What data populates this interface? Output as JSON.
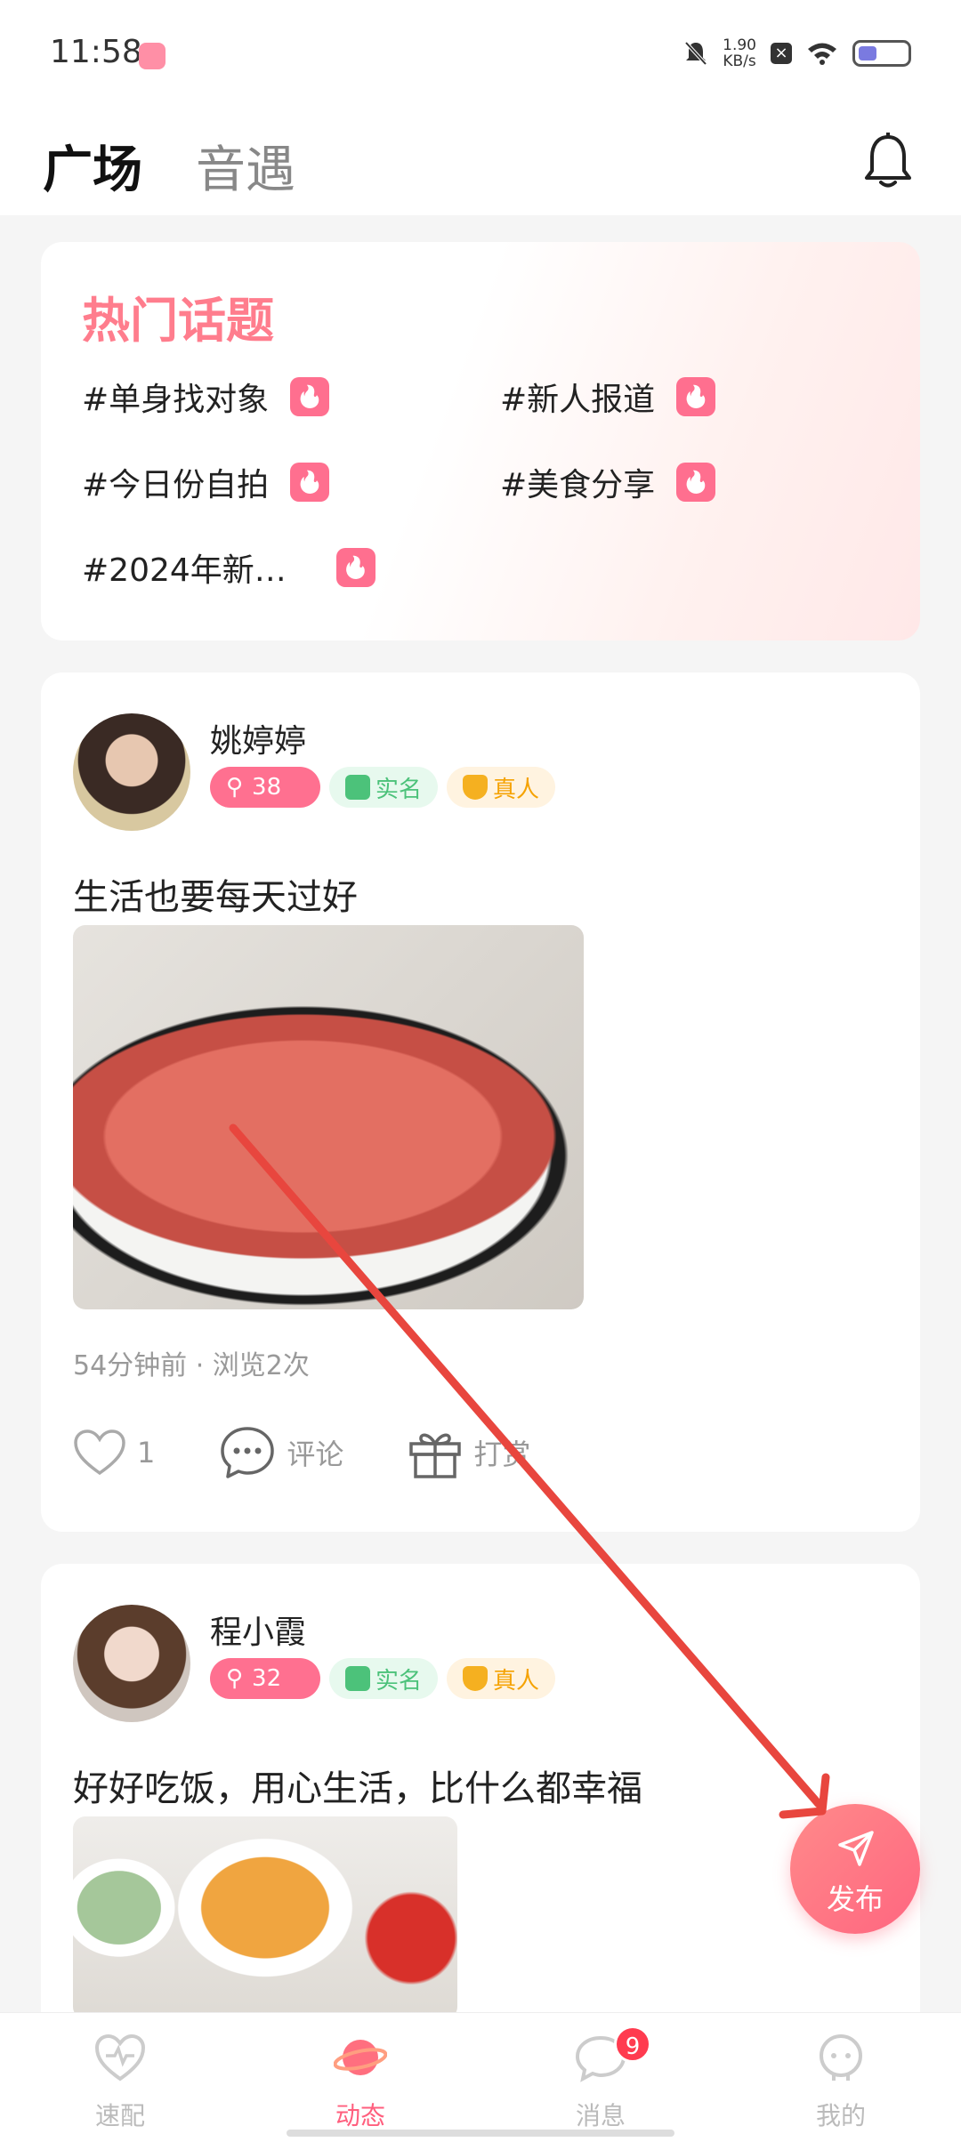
{
  "status_bar": {
    "time": "11:58",
    "net_speed_value": "1.90",
    "net_speed_unit": "KB/s"
  },
  "header": {
    "tab_active": "广场",
    "tab_inactive": "音遇"
  },
  "hot_topics": {
    "title": "热门话题",
    "topics": [
      "#单身找对象",
      "#新人报道",
      "#今日份自拍",
      "#美食分享",
      "#2024年新…"
    ]
  },
  "posts": [
    {
      "username": "姚婷婷",
      "level": "38",
      "badge_real": "实名",
      "badge_person": "真人",
      "text": "生活也要每天过好",
      "meta": "54分钟前 · 浏览2次",
      "likes": "1",
      "comment_label": "评论",
      "tip_label": "打赏"
    },
    {
      "username": "程小霞",
      "level": "32",
      "badge_real": "实名",
      "badge_person": "真人",
      "text": "好好吃饭，用心生活，比什么都幸福"
    }
  ],
  "fab": {
    "label": "发布"
  },
  "bottom_nav": {
    "items": [
      {
        "label": "速配"
      },
      {
        "label": "动态"
      },
      {
        "label": "消息",
        "badge": "9"
      },
      {
        "label": "我的"
      }
    ]
  },
  "colors": {
    "accent": "#ff6f8f",
    "topic_title": "#ff7d8d",
    "real_badge": "#4cc27a",
    "person_badge": "#f5a200",
    "annotation_arrow": "#e8463e"
  }
}
